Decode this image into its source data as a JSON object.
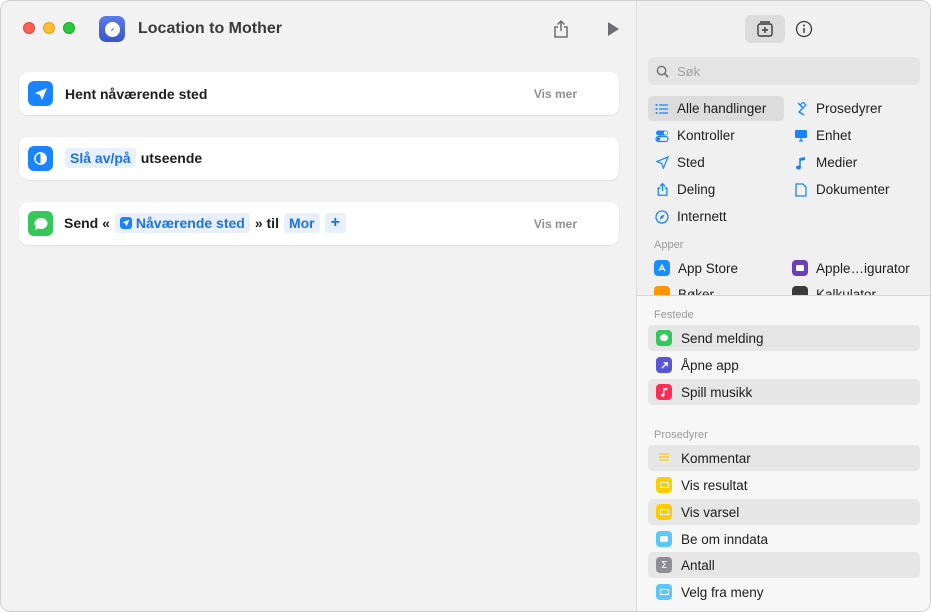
{
  "window": {
    "title": "Location to Mother"
  },
  "actions": [
    {
      "label": "Hent nåværende sted",
      "more": "Vis mer"
    },
    {
      "token": "Slå av/på",
      "label": "utseende"
    },
    {
      "prefix": "Send «",
      "token_var": "Nåværende sted",
      "middle": "» til",
      "token_recipient": "Mor",
      "add": "+",
      "more": "Vis mer"
    }
  ],
  "sidebar": {
    "search_placeholder": "Søk",
    "categories": [
      {
        "label": "Alle handlinger",
        "icon": "list-icon",
        "selected": true
      },
      {
        "label": "Prosedyrer",
        "icon": "scripting-icon"
      },
      {
        "label": "Kontroller",
        "icon": "toggles-icon"
      },
      {
        "label": "Enhet",
        "icon": "display-icon"
      },
      {
        "label": "Sted",
        "icon": "location-arrow-icon"
      },
      {
        "label": "Medier",
        "icon": "music-note-icon"
      },
      {
        "label": "Deling",
        "icon": "share-icon"
      },
      {
        "label": "Dokumenter",
        "icon": "document-icon"
      },
      {
        "label": "Internett",
        "icon": "compass-icon"
      }
    ],
    "apps_header": "Apper",
    "apps": [
      {
        "label": "App Store",
        "color": "#1a8cff"
      },
      {
        "label": "Apple…igurator",
        "color": "#6b3fb8"
      },
      {
        "label": "Bøker",
        "color": "#ff9500"
      },
      {
        "label": "Kalkulator",
        "color": "#3a3a3c"
      }
    ],
    "pinned_header": "Festede",
    "pinned": [
      {
        "label": "Send melding",
        "color": "#34c759"
      },
      {
        "label": "Åpne app",
        "color": "#5856d6"
      },
      {
        "label": "Spill musikk",
        "color": "#ff2d55"
      }
    ],
    "scripting_header": "Prosedyrer",
    "scripting": [
      {
        "label": "Kommentar",
        "color": "#ffd60a"
      },
      {
        "label": "Vis resultat",
        "color": "#ffcc00"
      },
      {
        "label": "Vis varsel",
        "color": "#ffcc00"
      },
      {
        "label": "Be om inndata",
        "color": "#5ac8fa"
      },
      {
        "label": "Antall",
        "color": "#8e8e93"
      },
      {
        "label": "Velg fra meny",
        "color": "#5ac8fa"
      }
    ]
  }
}
